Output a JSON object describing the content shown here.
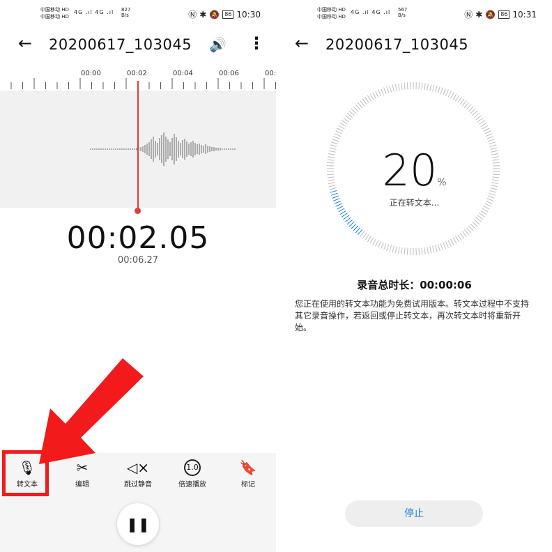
{
  "left": {
    "status": {
      "carrier1": "中国移动 HD",
      "carrier2": "中国移动 HD",
      "signal": "4G .ıl 4G .ıl",
      "speed_value": "827",
      "speed_unit": "B/s",
      "battery": "86",
      "time": "10:30"
    },
    "title": "20200617_103045",
    "timeline_labels": [
      "00:00",
      "00:02",
      "00:04",
      "00:06",
      "00:"
    ],
    "current_time": "00:02.05",
    "total_time": "00:06.27",
    "toolbar": [
      {
        "label": "转文本",
        "icon": "speech-to-text-icon"
      },
      {
        "label": "编辑",
        "icon": "scissors-edit-icon"
      },
      {
        "label": "跳过静音",
        "icon": "skip-silence-icon"
      },
      {
        "label": "倍速播放",
        "icon": "playback-speed-icon",
        "badge": "1.0"
      },
      {
        "label": "标记",
        "icon": "bookmark-icon"
      }
    ],
    "highlight_color": "#f21a1a"
  },
  "right": {
    "status": {
      "carrier1": "中国移动 HD",
      "carrier2": "中国移动 HD",
      "signal": "4G .ıl 4G .ıl",
      "speed_value": "567",
      "speed_unit": "B/s",
      "battery": "86",
      "time": "10:31"
    },
    "title": "20200617_103045",
    "progress_value": "20",
    "progress_fraction": 0.2,
    "progress_symbol": "%",
    "progress_text": "正在转文本...",
    "total_duration": "录音总时长：00:00:06",
    "notice": "您正在使用的转文本功能为免费试用版本。转文本过程中不支持其它录音操作，若返回或停止转文本，再次转文本时将重新开始。",
    "stop_label": "停止",
    "accent_color": "#1a7fd6"
  }
}
